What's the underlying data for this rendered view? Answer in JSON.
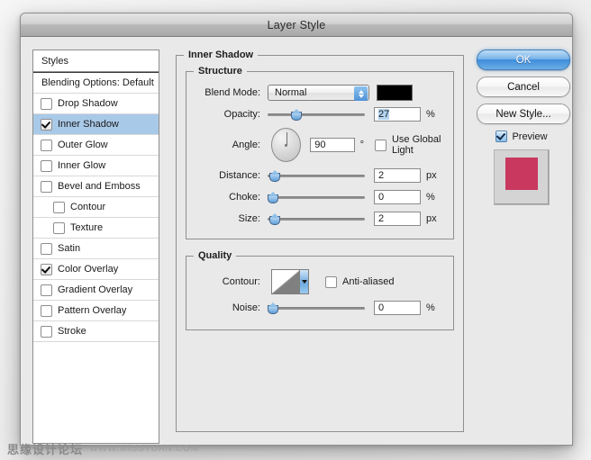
{
  "window": {
    "title": "Layer Style"
  },
  "sidebar": {
    "header": "Styles",
    "blending_options": "Blending Options: Default",
    "items": [
      {
        "label": "Drop Shadow",
        "checked": false,
        "selected": false,
        "indent": false
      },
      {
        "label": "Inner Shadow",
        "checked": true,
        "selected": true,
        "indent": false
      },
      {
        "label": "Outer Glow",
        "checked": false,
        "selected": false,
        "indent": false
      },
      {
        "label": "Inner Glow",
        "checked": false,
        "selected": false,
        "indent": false
      },
      {
        "label": "Bevel and Emboss",
        "checked": false,
        "selected": false,
        "indent": false
      },
      {
        "label": "Contour",
        "checked": false,
        "selected": false,
        "indent": true
      },
      {
        "label": "Texture",
        "checked": false,
        "selected": false,
        "indent": true
      },
      {
        "label": "Satin",
        "checked": false,
        "selected": false,
        "indent": false
      },
      {
        "label": "Color Overlay",
        "checked": true,
        "selected": false,
        "indent": false
      },
      {
        "label": "Gradient Overlay",
        "checked": false,
        "selected": false,
        "indent": false
      },
      {
        "label": "Pattern Overlay",
        "checked": false,
        "selected": false,
        "indent": false
      },
      {
        "label": "Stroke",
        "checked": false,
        "selected": false,
        "indent": false
      }
    ]
  },
  "main": {
    "group_title": "Inner Shadow",
    "structure": {
      "title": "Structure",
      "blend_mode": {
        "label": "Blend Mode:",
        "value": "Normal",
        "color": "#000000"
      },
      "opacity": {
        "label": "Opacity:",
        "value": "27",
        "unit": "%",
        "slider_pct": 27
      },
      "angle": {
        "label": "Angle:",
        "value": "90",
        "unit": "°",
        "degrees": 90,
        "global_light_label": "Use Global Light",
        "global_light_checked": false
      },
      "distance": {
        "label": "Distance:",
        "value": "2",
        "unit": "px",
        "slider_pct": 2
      },
      "choke": {
        "label": "Choke:",
        "value": "0",
        "unit": "%",
        "slider_pct": 0
      },
      "size": {
        "label": "Size:",
        "value": "2",
        "unit": "px",
        "slider_pct": 2
      }
    },
    "quality": {
      "title": "Quality",
      "contour": {
        "label": "Contour:",
        "anti_aliased_label": "Anti-aliased",
        "anti_aliased_checked": false
      },
      "noise": {
        "label": "Noise:",
        "value": "0",
        "unit": "%",
        "slider_pct": 0
      }
    }
  },
  "buttons": {
    "ok": "OK",
    "cancel": "Cancel",
    "new_style": "New Style...",
    "preview_label": "Preview",
    "preview_checked": true,
    "preview_color": "#c9385f"
  },
  "watermark": {
    "cn": "思缘设计论坛",
    "url": "WWW.MISSYUAN.COM"
  }
}
